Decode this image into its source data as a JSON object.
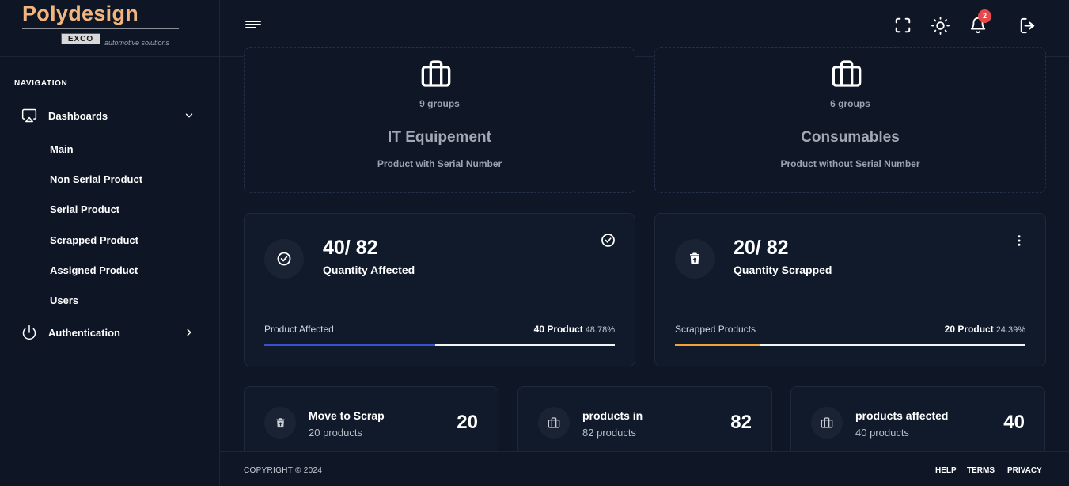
{
  "brand": {
    "name": "Polydesign",
    "sub_logo": "EXCO",
    "tagline": "automotive solutions"
  },
  "sidebar": {
    "section_title": "NAVIGATION",
    "dashboards": {
      "label": "Dashboards",
      "icon": "monitor-icon"
    },
    "sub_items": [
      "Main",
      "Non Serial Product",
      "Serial Product",
      "Scrapped Product",
      "Assigned Product",
      "Users"
    ],
    "authentication": {
      "label": "Authentication",
      "icon": "power-icon"
    }
  },
  "header": {
    "notification_count": "2"
  },
  "categories": [
    {
      "groups": "9 groups",
      "title": "IT Equipement",
      "subtitle": "Product with Serial Number"
    },
    {
      "groups": "6 groups",
      "title": "Consumables",
      "subtitle": "Product without Serial Number"
    }
  ],
  "stats": [
    {
      "value": "40/ 82",
      "label": "Quantity Affected",
      "progress_label": "Product Affected",
      "progress_value": "40 Product",
      "progress_pct": "48.78%",
      "fraction": 0.4878,
      "color": "#3b4fd1"
    },
    {
      "value": "20/ 82",
      "label": "Quantity Scrapped",
      "progress_label": "Scrapped Products",
      "progress_value": "20 Product",
      "progress_pct": "24.39%",
      "fraction": 0.2439,
      "color": "#f4a13a"
    }
  ],
  "mini": [
    {
      "title": "Move to Scrap",
      "sub": "20 products",
      "value": "20"
    },
    {
      "title": "products in",
      "sub": "82 products",
      "value": "82"
    },
    {
      "title": "products affected",
      "sub": "40 products",
      "value": "40"
    }
  ],
  "footer": {
    "copyright": "COPYRIGHT © 2024",
    "help": "HELP",
    "terms": "TERMS",
    "privacy": "PRIVACY"
  }
}
